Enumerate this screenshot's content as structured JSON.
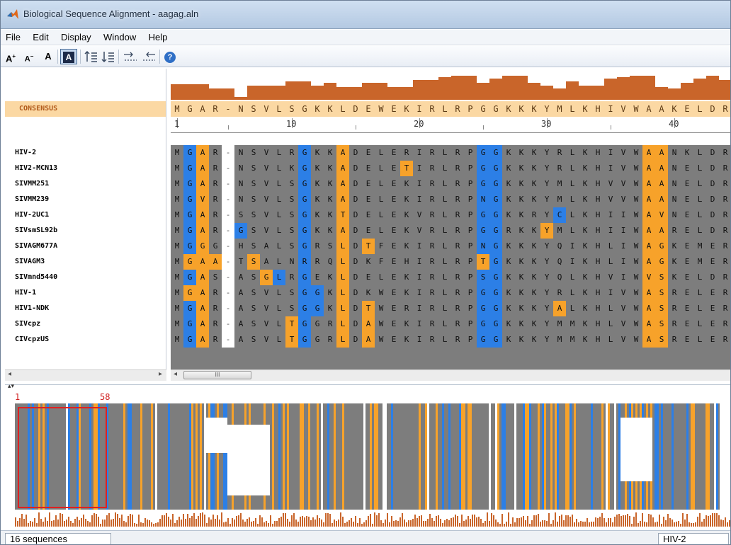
{
  "window": {
    "title": "Biological Sequence Alignment - aagag.aln"
  },
  "menu": [
    "File",
    "Edit",
    "Display",
    "Window",
    "Help"
  ],
  "toolbar": {
    "font_increase": "A",
    "font_decrease": "A",
    "font_reset": "A",
    "color_toggle": "A",
    "help": "?"
  },
  "consensus": {
    "label": "CONSENSUS",
    "sequence": "MGAR-NSVLSGKKLDEWEKIRLRPGGKKKYMLKHIVWAAKELDR",
    "bar_levels": [
      0.55,
      0.55,
      0.55,
      0.4,
      0.4,
      0.1,
      0.5,
      0.5,
      0.5,
      0.65,
      0.65,
      0.5,
      0.6,
      0.45,
      0.45,
      0.6,
      0.6,
      0.45,
      0.45,
      0.7,
      0.7,
      0.8,
      0.85,
      0.85,
      0.6,
      0.75,
      0.85,
      0.85,
      0.6,
      0.5,
      0.4,
      0.65,
      0.5,
      0.5,
      0.75,
      0.8,
      0.85,
      0.85,
      0.45,
      0.4,
      0.6,
      0.75,
      0.85,
      0.7
    ]
  },
  "ruler": {
    "labels": [
      "1",
      "10",
      "20",
      "30",
      "40"
    ]
  },
  "colors": {
    "consensus_bg": "#fbd8a3",
    "bar": "#c9652a",
    "gray": "#7d7d7d",
    "blue": "#2c7fe6",
    "orange": "#f7a22a",
    "selection": "#e02020"
  },
  "sequences": [
    {
      "name": "HIV-2",
      "seq": "MGAR-NSVLRGKKADELERIRLRPGGKKKYRLKHIVWAANKLDR"
    },
    {
      "name": "HIV2-MCN13",
      "seq": "MGAR-NSVLKGKKADELETIRLRPGGKKKYRLKHIVWAANELDR"
    },
    {
      "name": "SIVMM251",
      "seq": "MGAR-NSVLSGKKADELEKIRLRPGGKKKYMLKHVVWAANELDR"
    },
    {
      "name": "SIVMM239",
      "seq": "MGVR-NSVLSGKKADELEKIRLRPNGKKKYMLKHVVWAANELDR"
    },
    {
      "name": "HIV-2UC1",
      "seq": "MGAR-SSVLSGKKTDELEKVRLRPGGKKRYCLKHIIWAVNELDR"
    },
    {
      "name": "SIVsmSL92b",
      "seq": "MGAR-GSVLSGKKADELEKVRLRPGGRKKYMLKHIIWAAREL DR"
    },
    {
      "name": "SIVAGM677A",
      "seq": "MGGG-HSALSGRSLDTFEKIRLRPNGKKKYQIKHLIWAGKEMER"
    },
    {
      "name": "SIVAGM3",
      "seq": "MGAA-TSALNRRQLDKFEHIRLRPTGKKKYQIKHLIWAGKEMER"
    },
    {
      "name": "SIVmnd5440",
      "seq": "MGAS-ASGLRGEKLDELEKIRLRPSGKKKYQLKHVIWVSKELDR"
    },
    {
      "name": "HIV-1",
      "seq": "MGAR-ASVLSGGKLDKWEKIRLRPGGKKKYRLKHIVWASRELER"
    },
    {
      "name": "HIV1-NDK",
      "seq": "MGAR-ASVLSGGKLDTWERIRLRPGGKKKYALKHLVWASRELER"
    },
    {
      "name": "SIVcpz",
      "seq": "MGAR-ASVLTGGRLDAWEKIRLRPGGKKKYMMKHLVWASRELER"
    },
    {
      "name": "CIVcpzUS",
      "seq": "MGAR-ASVLTGGRLDAWEKIRLRPGGKKKYMMKHLVWASRELER"
    }
  ],
  "highlight": {
    "blue_cols": [
      1,
      10,
      24,
      25
    ],
    "orange_cols": [
      2,
      13,
      37,
      38
    ],
    "extra_orange": [
      [
        1,
        18
      ],
      [
        9,
        1
      ],
      [
        5,
        29
      ],
      [
        6,
        15
      ],
      [
        7,
        1
      ],
      [
        7,
        3
      ],
      [
        7,
        6
      ],
      [
        7,
        24
      ],
      [
        8,
        7
      ],
      [
        10,
        15
      ],
      [
        10,
        30
      ],
      [
        11,
        9
      ],
      [
        12,
        9
      ],
      [
        11,
        15
      ],
      [
        12,
        15
      ]
    ],
    "extra_blue": [
      [
        4,
        30
      ],
      [
        5,
        5
      ],
      [
        8,
        8
      ],
      [
        8,
        10
      ],
      [
        9,
        10
      ],
      [
        9,
        11
      ],
      [
        10,
        10
      ],
      [
        10,
        11
      ]
    ],
    "white_cols": [
      4
    ]
  },
  "overview": {
    "range_start": "1",
    "range_end": "58"
  },
  "status": {
    "count": "16 sequences",
    "selected": "HIV-2"
  }
}
